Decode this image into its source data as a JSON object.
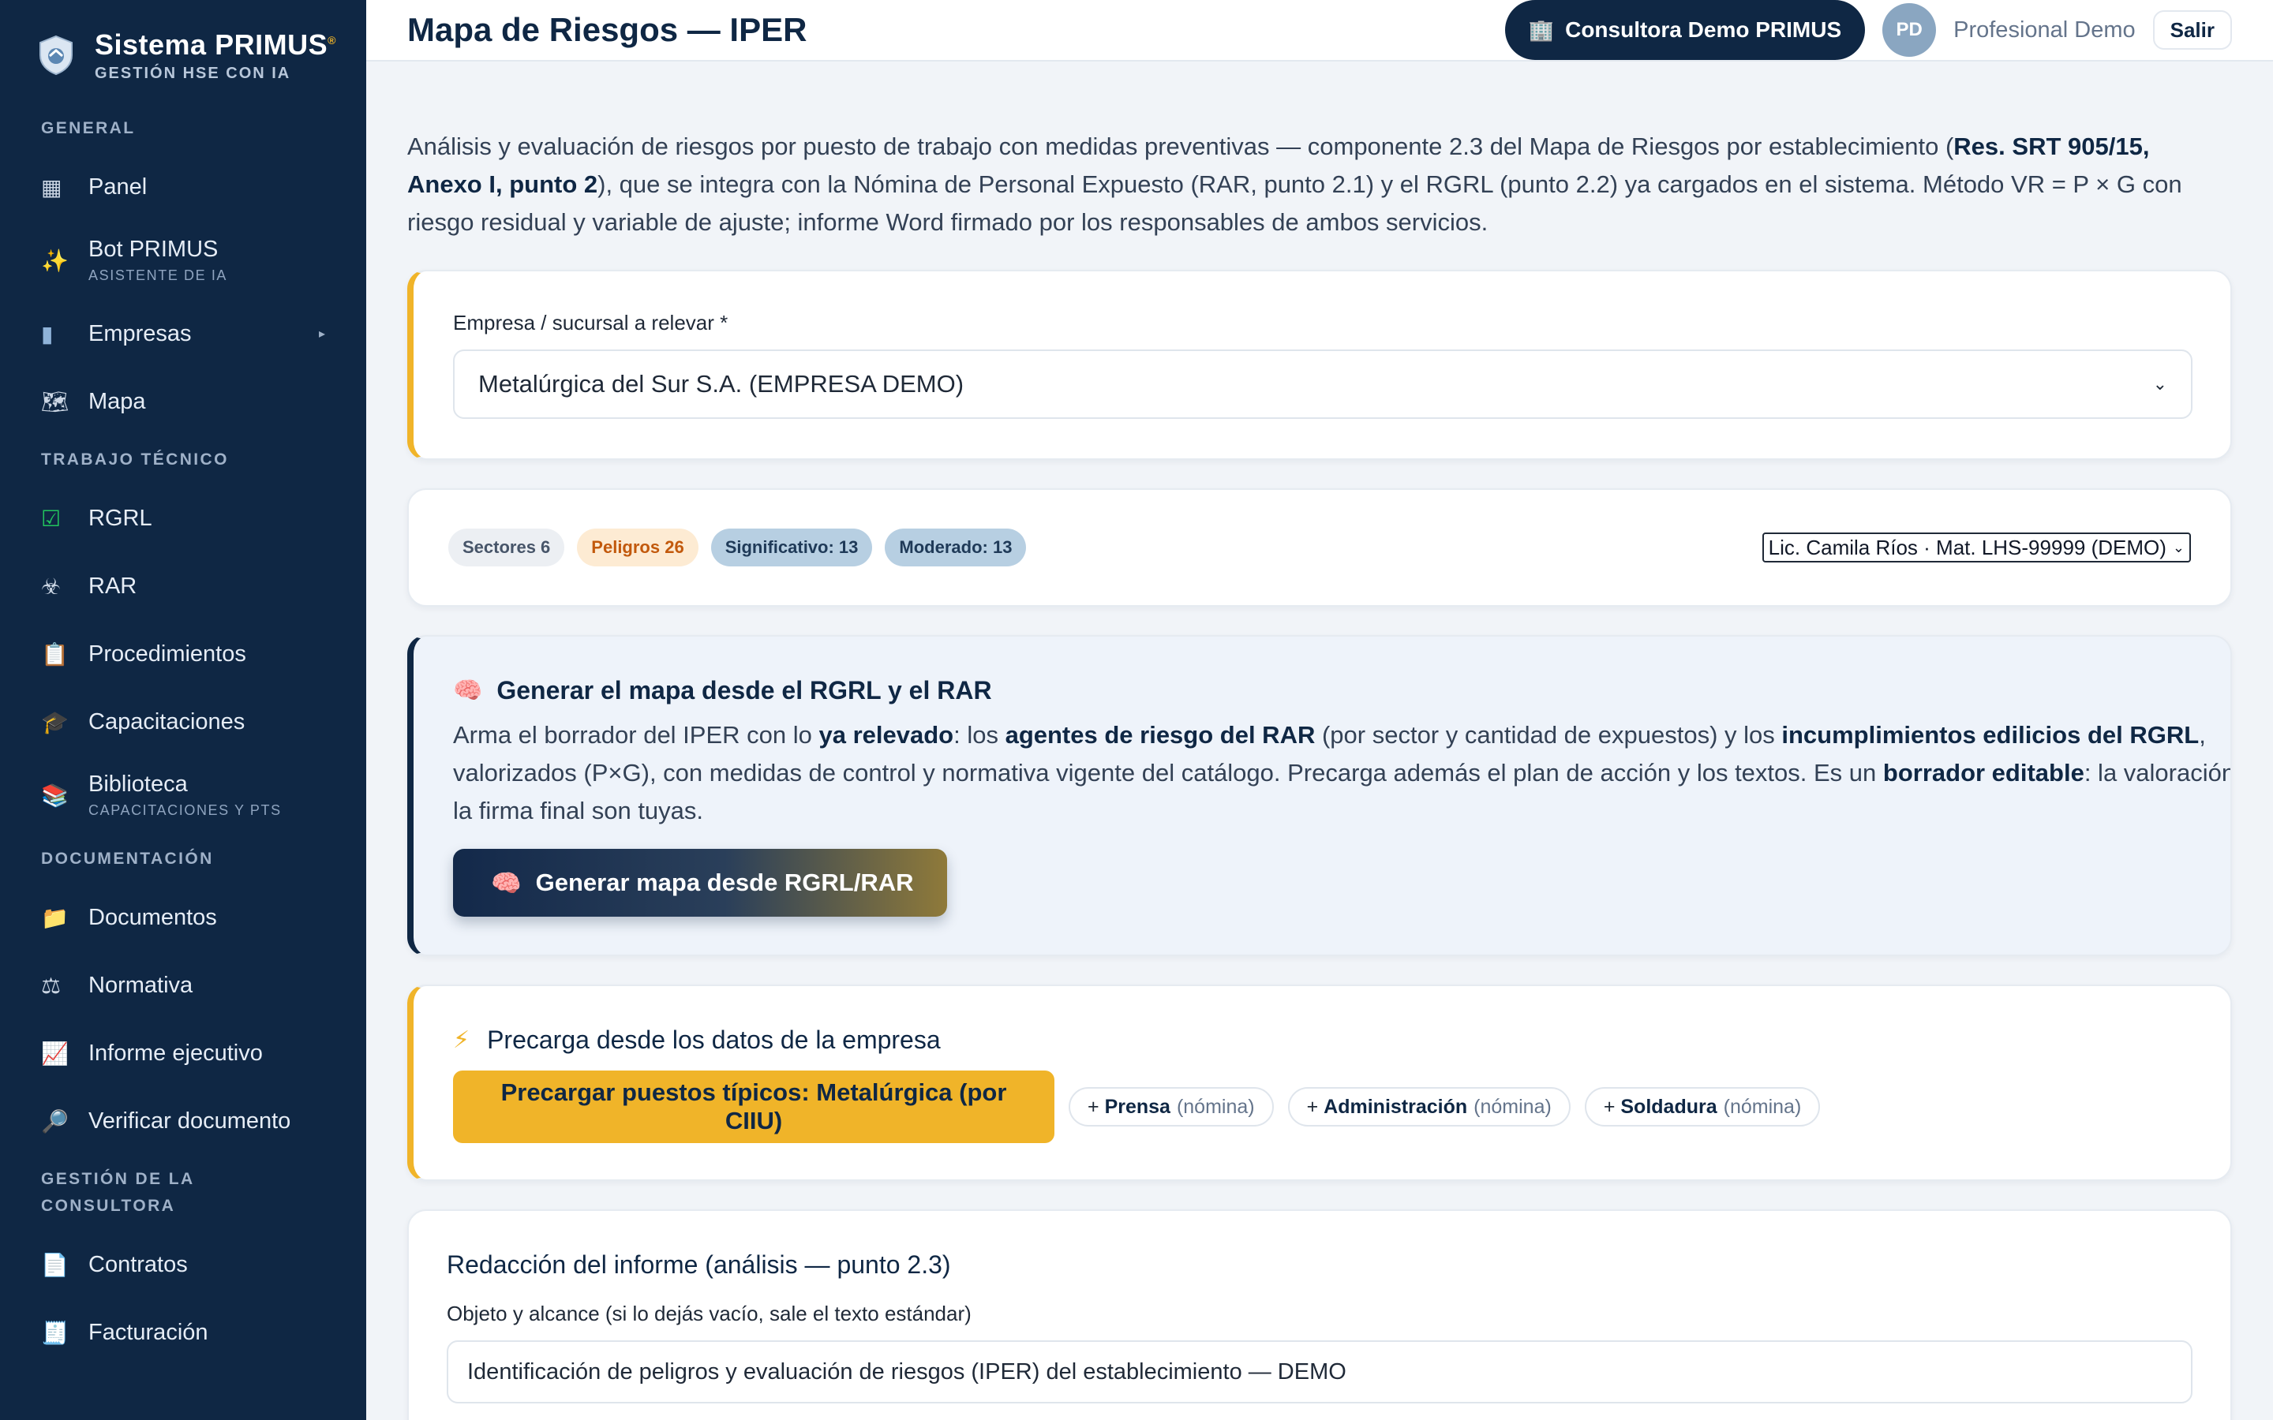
{
  "brand": {
    "title": "Sistema PRIMUS",
    "mark": "®",
    "subtitle": "GESTIÓN HSE CON IA"
  },
  "sidebar": {
    "sections": [
      {
        "title": "GENERAL",
        "items": [
          {
            "label": "Panel",
            "icon": "grid-icon"
          },
          {
            "label": "Bot PRIMUS",
            "sublabel": "ASISTENTE DE IA",
            "icon": "sparkles-icon"
          },
          {
            "label": "Empresas",
            "icon": "building-icon",
            "has_children": true
          },
          {
            "label": "Mapa",
            "icon": "world-map-icon"
          }
        ]
      },
      {
        "title": "TRABAJO TÉCNICO",
        "items": [
          {
            "label": "RGRL",
            "icon": "check-box-icon"
          },
          {
            "label": "RAR",
            "icon": "biohazard-icon"
          },
          {
            "label": "Procedimientos",
            "icon": "clipboard-icon"
          },
          {
            "label": "Capacitaciones",
            "icon": "graduation-cap-icon"
          },
          {
            "label": "Biblioteca",
            "sublabel": "CAPACITACIONES Y PTS",
            "icon": "books-icon"
          }
        ]
      },
      {
        "title": "DOCUMENTACIÓN",
        "items": [
          {
            "label": "Documentos",
            "icon": "folder-icon"
          },
          {
            "label": "Normativa",
            "icon": "scales-icon"
          },
          {
            "label": "Informe ejecutivo",
            "icon": "chart-up-icon"
          },
          {
            "label": "Verificar documento",
            "icon": "magnifier-icon"
          }
        ]
      },
      {
        "title": "GESTIÓN DE LA CONSULTORA",
        "items": [
          {
            "label": "Contratos",
            "icon": "document-icon"
          },
          {
            "label": "Facturación",
            "icon": "receipt-icon"
          }
        ]
      }
    ]
  },
  "header": {
    "title": "Mapa de Riesgos — IPER",
    "tenant": "Consultora Demo PRIMUS",
    "avatar_initials": "PD",
    "user": "Profesional Demo",
    "logout": "Salir"
  },
  "intro": {
    "t1": "Análisis y evaluación de riesgos por puesto de trabajo con medidas preventivas — componente 2.3 del Mapa de Riesgos por establecimiento (",
    "b1": "Res. SRT 905/15, Anexo I, punto 2",
    "t2": "), que se integra con la Nómina de Personal Expuesto (RAR, punto 2.1) y el RGRL (punto 2.2) ya cargados en el sistema. Método VR = P × G con riesgo residual y variable de ajuste; informe Word firmado por los responsables de ambos servicios."
  },
  "company": {
    "label": "Empresa / sucursal a relevar *",
    "selected": "Metalúrgica del Sur S.A. (EMPRESA DEMO)"
  },
  "stats": {
    "sectores": "Sectores 6",
    "peligros": "Peligros 26",
    "significativo": "Significativo: 13",
    "moderado": "Moderado: 13",
    "signer": "Lic. Camila Ríos · Mat. LHS-99999 (DEMO)"
  },
  "generate": {
    "title": "Generar el mapa desde el RGRL y el RAR",
    "p1": "Arma el borrador del IPER con lo ",
    "b1": "ya relevado",
    "p2": ": los ",
    "b2": "agentes de riesgo del RAR",
    "p3": " (por sector y cantidad de expuestos) y los ",
    "b3": "incumplimientos edilicios del RGRL",
    "p4": ", valorizados (P×G), con medidas de control y normativa vigente del catálogo. Precarga además el plan de acción y los textos. Es un ",
    "b4": "borrador editable",
    "p5": ": la valoración y la firma final son tuyas.",
    "button": "Generar mapa desde RGRL/RAR"
  },
  "preload": {
    "title": "Precarga desde los datos de la empresa",
    "button": "Precargar puestos típicos: Metalúrgica (por CIIU)",
    "chips": [
      {
        "plus": "+",
        "name": "Prensa",
        "tag": "(nómina)"
      },
      {
        "plus": "+",
        "name": "Administración",
        "tag": "(nómina)"
      },
      {
        "plus": "+",
        "name": "Soldadura",
        "tag": "(nómina)"
      }
    ]
  },
  "report": {
    "title": "Redacción del informe (análisis — punto 2.3)",
    "label": "Objeto y alcance (si lo dejás vacío, sale el texto estándar)",
    "value": "Identificación de peligros y evaluación de riesgos (IPER) del establecimiento — DEMO"
  },
  "colors": {
    "navy": "#0f2744",
    "accent": "#f0b429",
    "background": "#f1f4f8"
  }
}
